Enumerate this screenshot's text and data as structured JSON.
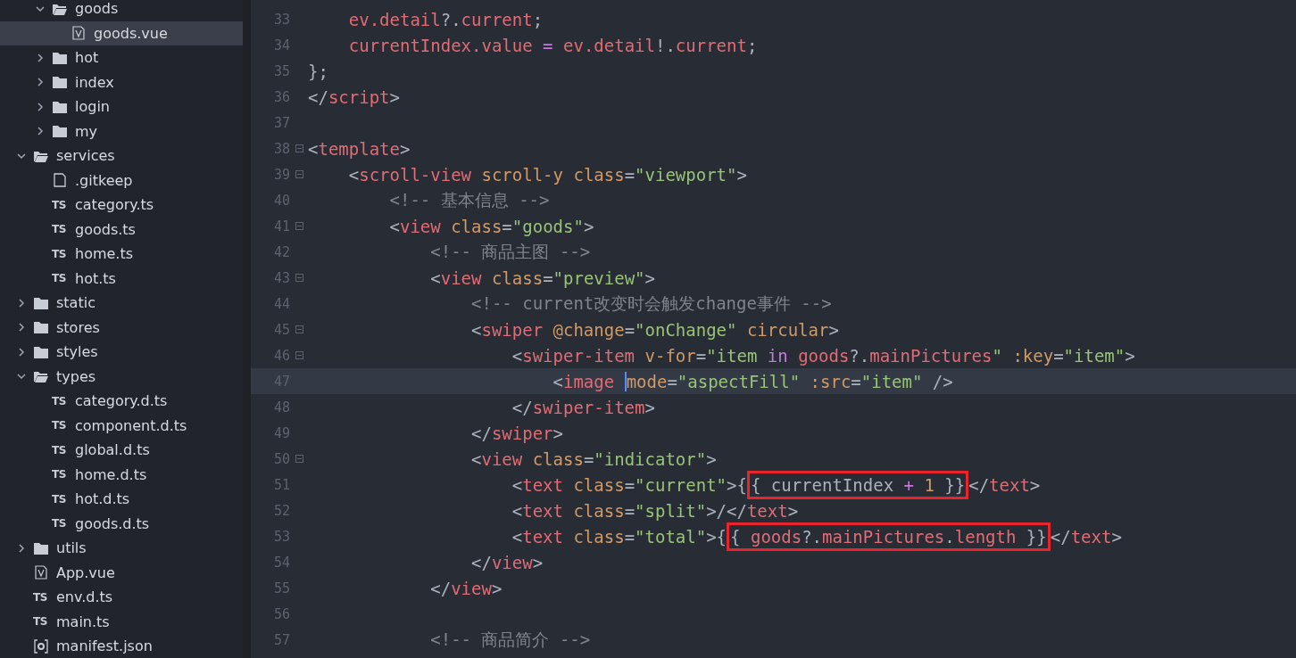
{
  "sidebar": {
    "tree": [
      {
        "children": [
          {
            "label": "goods",
            "kind": "folder",
            "expanded": true,
            "selected": false,
            "children": [
              {
                "label": "goods.vue",
                "kind": "vue",
                "selected": true
              }
            ]
          },
          {
            "label": "hot",
            "kind": "folder",
            "expanded": false,
            "selected": false
          },
          {
            "label": "index",
            "kind": "folder",
            "expanded": false,
            "selected": false
          },
          {
            "label": "login",
            "kind": "folder",
            "expanded": false,
            "selected": false
          },
          {
            "label": "my",
            "kind": "folder",
            "expanded": false,
            "selected": false
          }
        ]
      },
      {
        "label": "services",
        "kind": "folder",
        "expanded": true,
        "selected": false,
        "children": [
          {
            "label": ".gitkeep",
            "kind": "file",
            "selected": false
          },
          {
            "label": "category.ts",
            "kind": "ts",
            "icon_label": "TS",
            "selected": false
          },
          {
            "label": "goods.ts",
            "kind": "ts",
            "icon_label": "TS",
            "selected": false
          },
          {
            "label": "home.ts",
            "kind": "ts",
            "icon_label": "TS",
            "selected": false
          },
          {
            "label": "hot.ts",
            "kind": "ts",
            "icon_label": "TS",
            "selected": false
          }
        ]
      },
      {
        "label": "static",
        "kind": "folder",
        "expanded": false,
        "selected": false
      },
      {
        "label": "stores",
        "kind": "folder",
        "expanded": false,
        "selected": false
      },
      {
        "label": "styles",
        "kind": "folder",
        "expanded": false,
        "selected": false
      },
      {
        "label": "types",
        "kind": "folder",
        "expanded": true,
        "selected": false,
        "children": [
          {
            "label": "category.d.ts",
            "kind": "ts",
            "icon_label": "TS",
            "selected": false
          },
          {
            "label": "component.d.ts",
            "kind": "ts",
            "icon_label": "TS",
            "selected": false
          },
          {
            "label": "global.d.ts",
            "kind": "ts",
            "icon_label": "TS",
            "selected": false
          },
          {
            "label": "home.d.ts",
            "kind": "ts",
            "icon_label": "TS",
            "selected": false
          },
          {
            "label": "hot.d.ts",
            "kind": "ts",
            "icon_label": "TS",
            "selected": false
          },
          {
            "label": "goods.d.ts",
            "kind": "ts",
            "icon_label": "TS",
            "selected": false
          }
        ]
      },
      {
        "label": "utils",
        "kind": "folder",
        "expanded": false,
        "selected": false
      },
      {
        "label": "App.vue",
        "kind": "vue",
        "selected": false
      },
      {
        "label": "env.d.ts",
        "kind": "ts",
        "icon_label": "TS",
        "selected": false
      },
      {
        "label": "main.ts",
        "kind": "ts",
        "icon_label": "TS",
        "selected": false
      },
      {
        "label": "manifest.json",
        "kind": "json",
        "selected": false
      }
    ]
  },
  "editor": {
    "lines": [
      {
        "number": "33",
        "fold": false,
        "current": false,
        "tokens": [
          {
            "kind": "var",
            "text": "    ev.detail"
          },
          {
            "kind": "punct",
            "text": "?."
          },
          {
            "kind": "var",
            "text": "current"
          },
          {
            "kind": "punct",
            "text": ";"
          }
        ]
      },
      {
        "number": "34",
        "fold": false,
        "current": false,
        "tokens": [
          {
            "kind": "var",
            "text": "    currentIndex.value"
          },
          {
            "kind": "op",
            "text": " = "
          },
          {
            "kind": "var",
            "text": "ev.detail"
          },
          {
            "kind": "punct",
            "text": "!."
          },
          {
            "kind": "var",
            "text": "current"
          },
          {
            "kind": "punct",
            "text": ";"
          }
        ]
      },
      {
        "number": "35",
        "fold": false,
        "current": false,
        "tokens": [
          {
            "kind": "punct",
            "text": "};"
          }
        ]
      },
      {
        "number": "36",
        "fold": false,
        "current": false,
        "tokens": [
          {
            "kind": "punct",
            "text": "</"
          },
          {
            "kind": "tag",
            "text": "script"
          },
          {
            "kind": "punct",
            "text": ">"
          }
        ]
      },
      {
        "number": "37",
        "fold": false,
        "current": false
      },
      {
        "number": "38",
        "fold": true,
        "current": false,
        "tokens": [
          {
            "kind": "punct",
            "text": "<"
          },
          {
            "kind": "tag",
            "text": "template"
          },
          {
            "kind": "punct",
            "text": ">"
          }
        ]
      },
      {
        "number": "39",
        "fold": true,
        "current": false,
        "tokens": [
          {
            "kind": "punct",
            "text": "    <"
          },
          {
            "kind": "tag",
            "text": "scroll-view"
          },
          {
            "kind": "attr",
            "text": " scroll-y class"
          },
          {
            "kind": "punct",
            "text": "="
          },
          {
            "kind": "string",
            "text": "\"viewport\""
          },
          {
            "kind": "punct",
            "text": ">"
          }
        ]
      },
      {
        "number": "40",
        "fold": false,
        "current": false,
        "tokens": [
          {
            "kind": "comment",
            "text": "        <!-- 基本信息 -->"
          }
        ]
      },
      {
        "number": "41",
        "fold": true,
        "current": false,
        "tokens": [
          {
            "kind": "punct",
            "text": "        <"
          },
          {
            "kind": "tag",
            "text": "view"
          },
          {
            "kind": "attr",
            "text": " class"
          },
          {
            "kind": "punct",
            "text": "="
          },
          {
            "kind": "string",
            "text": "\"goods\""
          },
          {
            "kind": "punct",
            "text": ">"
          }
        ]
      },
      {
        "number": "42",
        "fold": false,
        "current": false,
        "tokens": [
          {
            "kind": "comment",
            "text": "            <!-- 商品主图 -->"
          }
        ]
      },
      {
        "number": "43",
        "fold": true,
        "current": false,
        "tokens": [
          {
            "kind": "punct",
            "text": "            <"
          },
          {
            "kind": "tag",
            "text": "view"
          },
          {
            "kind": "attr",
            "text": " class"
          },
          {
            "kind": "punct",
            "text": "="
          },
          {
            "kind": "string",
            "text": "\"preview\""
          },
          {
            "kind": "punct",
            "text": ">"
          }
        ]
      },
      {
        "number": "44",
        "fold": false,
        "current": false,
        "tokens": [
          {
            "kind": "comment",
            "text": "                <!-- current改变时会触发change事件 -->"
          }
        ]
      },
      {
        "number": "45",
        "fold": true,
        "current": false,
        "tokens": [
          {
            "kind": "punct",
            "text": "                <"
          },
          {
            "kind": "tag",
            "text": "swiper"
          },
          {
            "kind": "attr",
            "text": " @change"
          },
          {
            "kind": "punct",
            "text": "="
          },
          {
            "kind": "string",
            "text": "\"onChange\""
          },
          {
            "kind": "attr",
            "text": " circular"
          },
          {
            "kind": "punct",
            "text": ">"
          }
        ]
      },
      {
        "number": "46",
        "fold": true,
        "current": false,
        "tokens": [
          {
            "kind": "punct",
            "text": "                    <"
          },
          {
            "kind": "tag",
            "text": "swiper-item"
          },
          {
            "kind": "attr",
            "text": " v-for"
          },
          {
            "kind": "punct",
            "text": "="
          },
          {
            "kind": "string",
            "text": "\"item "
          },
          {
            "kind": "keyword",
            "text": "in"
          },
          {
            "kind": "var",
            "text": " goods"
          },
          {
            "kind": "punct",
            "text": "?."
          },
          {
            "kind": "var",
            "text": "mainPictures"
          },
          {
            "kind": "string",
            "text": "\""
          },
          {
            "kind": "attr",
            "text": " :key"
          },
          {
            "kind": "punct",
            "text": "="
          },
          {
            "kind": "string",
            "text": "\"item\""
          },
          {
            "kind": "punct",
            "text": ">"
          }
        ]
      },
      {
        "number": "47",
        "fold": false,
        "current": true,
        "tokens": [
          {
            "kind": "punct",
            "text": "                        <"
          },
          {
            "kind": "tag",
            "text": "image "
          },
          {
            "kind": "caret"
          },
          {
            "kind": "attr",
            "text": "mode"
          },
          {
            "kind": "punct",
            "text": "="
          },
          {
            "kind": "string",
            "text": "\"aspectFill\""
          },
          {
            "kind": "attr",
            "text": " :src"
          },
          {
            "kind": "punct",
            "text": "="
          },
          {
            "kind": "string",
            "text": "\"item\""
          },
          {
            "kind": "punct",
            "text": " />"
          }
        ]
      },
      {
        "number": "48",
        "fold": false,
        "current": false,
        "tokens": [
          {
            "kind": "punct",
            "text": "                    </"
          },
          {
            "kind": "tag",
            "text": "swiper-item"
          },
          {
            "kind": "punct",
            "text": ">"
          }
        ]
      },
      {
        "number": "49",
        "fold": false,
        "current": false,
        "tokens": [
          {
            "kind": "punct",
            "text": "                </"
          },
          {
            "kind": "tag",
            "text": "swiper"
          },
          {
            "kind": "punct",
            "text": ">"
          }
        ]
      },
      {
        "number": "50",
        "fold": true,
        "current": false,
        "tokens": [
          {
            "kind": "punct",
            "text": "                <"
          },
          {
            "kind": "tag",
            "text": "view"
          },
          {
            "kind": "attr",
            "text": " class"
          },
          {
            "kind": "punct",
            "text": "="
          },
          {
            "kind": "string",
            "text": "\"indicator\""
          },
          {
            "kind": "punct",
            "text": ">"
          }
        ]
      },
      {
        "number": "51",
        "fold": false,
        "current": false,
        "tokens": [
          {
            "kind": "punct",
            "text": "                    <"
          },
          {
            "kind": "tag",
            "text": "text"
          },
          {
            "kind": "attr",
            "text": " class"
          },
          {
            "kind": "punct",
            "text": "="
          },
          {
            "kind": "string",
            "text": "\"current\""
          },
          {
            "kind": "punct",
            "text": ">{"
          },
          {
            "kind": "box",
            "tokens": [
              {
                "kind": "punct",
                "text": "{ currentIndex "
              },
              {
                "kind": "op",
                "text": "+"
              },
              {
                "kind": "number",
                "text": " 1"
              },
              {
                "kind": "punct",
                "text": " }}"
              }
            ]
          },
          {
            "kind": "punct",
            "text": "</"
          },
          {
            "kind": "tag",
            "text": "text"
          },
          {
            "kind": "punct",
            "text": ">"
          }
        ]
      },
      {
        "number": "52",
        "fold": false,
        "current": false,
        "tokens": [
          {
            "kind": "punct",
            "text": "                    <"
          },
          {
            "kind": "tag",
            "text": "text"
          },
          {
            "kind": "attr",
            "text": " class"
          },
          {
            "kind": "punct",
            "text": "="
          },
          {
            "kind": "string",
            "text": "\"split\""
          },
          {
            "kind": "punct",
            "text": ">/</"
          },
          {
            "kind": "tag",
            "text": "text"
          },
          {
            "kind": "punct",
            "text": ">"
          }
        ]
      },
      {
        "number": "53",
        "fold": false,
        "current": false,
        "tokens": [
          {
            "kind": "punct",
            "text": "                    <"
          },
          {
            "kind": "tag",
            "text": "text"
          },
          {
            "kind": "attr",
            "text": " class"
          },
          {
            "kind": "punct",
            "text": "="
          },
          {
            "kind": "string",
            "text": "\"total\""
          },
          {
            "kind": "punct",
            "text": ">{"
          },
          {
            "kind": "box",
            "tokens": [
              {
                "kind": "punct",
                "text": "{ "
              },
              {
                "kind": "var",
                "text": "goods"
              },
              {
                "kind": "punct",
                "text": "?."
              },
              {
                "kind": "var",
                "text": "mainPictures"
              },
              {
                "kind": "punct",
                "text": "."
              },
              {
                "kind": "var",
                "text": "length"
              },
              {
                "kind": "punct",
                "text": " }}"
              }
            ]
          },
          {
            "kind": "punct",
            "text": "</"
          },
          {
            "kind": "tag",
            "text": "text"
          },
          {
            "kind": "punct",
            "text": ">"
          }
        ]
      },
      {
        "number": "54",
        "fold": false,
        "current": false,
        "tokens": [
          {
            "kind": "punct",
            "text": "                </"
          },
          {
            "kind": "tag",
            "text": "view"
          },
          {
            "kind": "punct",
            "text": ">"
          }
        ]
      },
      {
        "number": "55",
        "fold": false,
        "current": false,
        "tokens": [
          {
            "kind": "punct",
            "text": "            </"
          },
          {
            "kind": "tag",
            "text": "view"
          },
          {
            "kind": "punct",
            "text": ">"
          }
        ]
      },
      {
        "number": "56",
        "fold": false,
        "current": false
      },
      {
        "number": "57",
        "fold": false,
        "current": false,
        "tokens": [
          {
            "kind": "comment",
            "text": "            <!-- 商品简介 -->"
          }
        ]
      }
    ]
  }
}
